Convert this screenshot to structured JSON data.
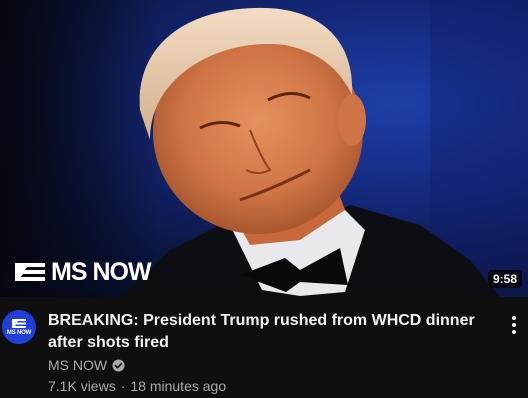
{
  "video": {
    "brand_text": "MS NOW",
    "duration": "9:58",
    "title": "BREAKING: President Trump rushed from WHCD dinner after shots fired",
    "channel": {
      "name": "MS NOW",
      "avatar_text": "MS NOW",
      "verified_icon": "check-circle-icon"
    },
    "views": "7.1K views",
    "separator": "·",
    "age": "18 minutes ago",
    "menu_icon": "more-vert-icon"
  },
  "colors": {
    "background": "#0f0f0f",
    "primary_text": "#f1f1f1",
    "secondary_text": "#aaaaaa",
    "avatar_bg": "#1f3fd8"
  }
}
